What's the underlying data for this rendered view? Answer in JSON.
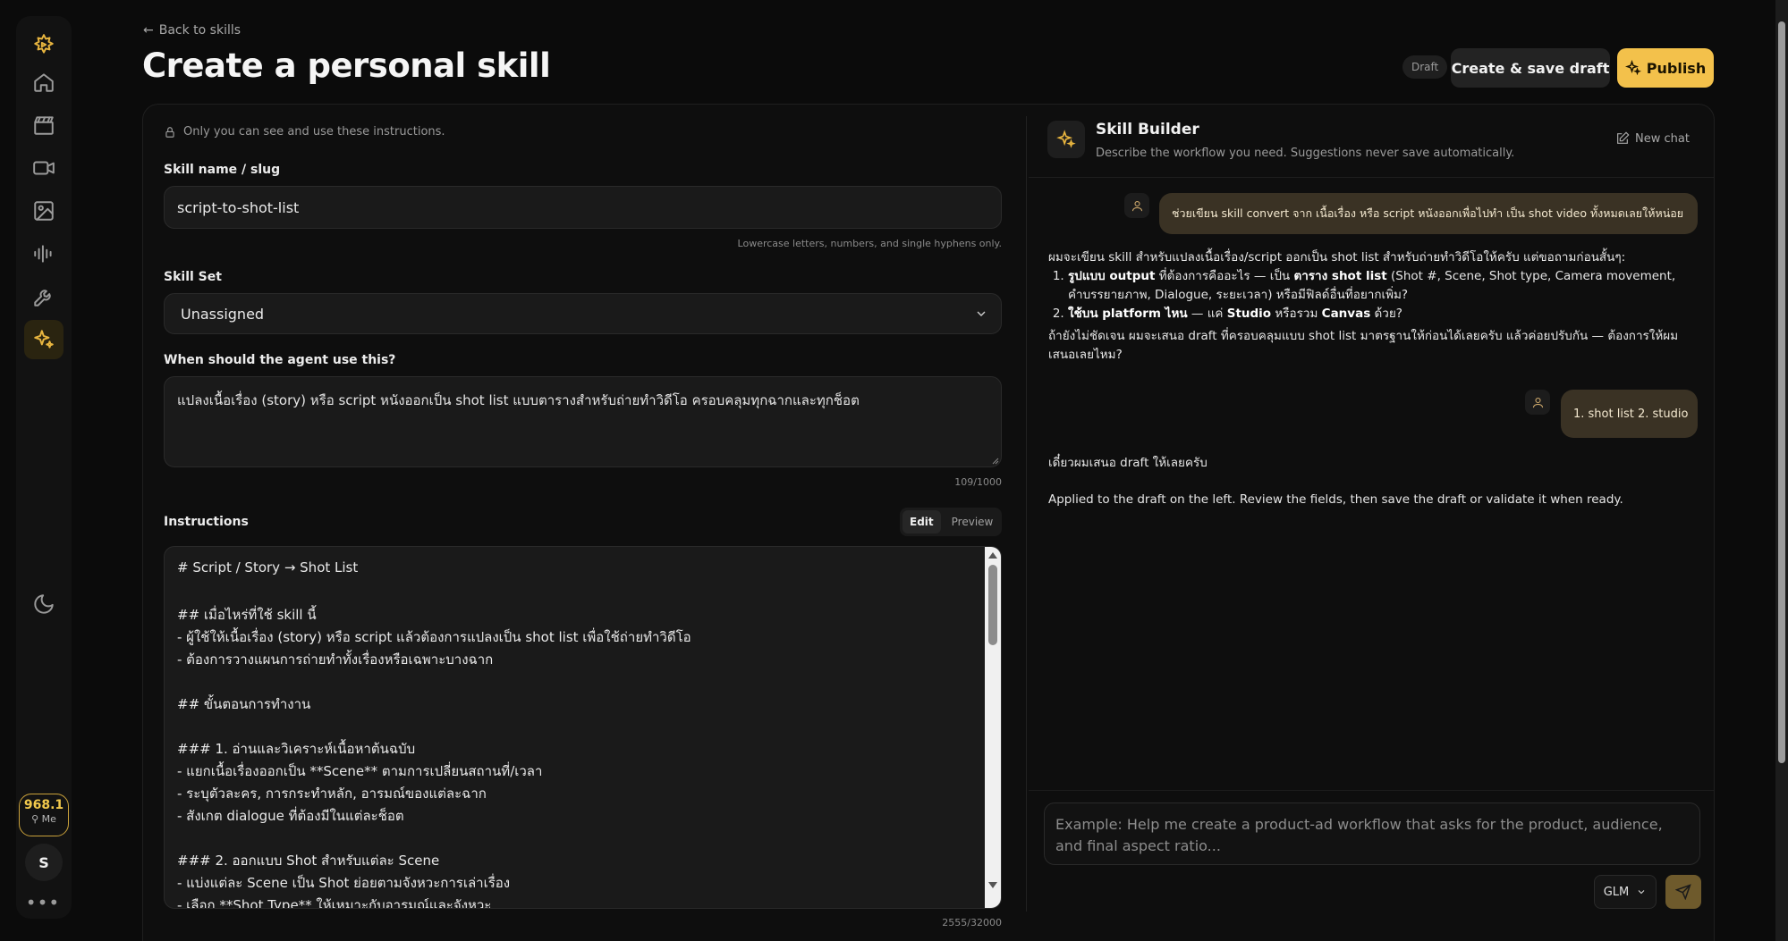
{
  "header": {
    "back_label": "Back to skills",
    "title": "Create a personal skill",
    "draft_badge": "Draft",
    "save_label": "Create & save draft",
    "publish_label": "Publish"
  },
  "sidebar": {
    "credits": "968.1",
    "me_label": "Me",
    "avatar_initial": "S",
    "more": "•••"
  },
  "form": {
    "privacy_note": "Only you can see and use these instructions.",
    "name_label": "Skill name / slug",
    "name_value": "script-to-shot-list",
    "name_hint": "Lowercase letters, numbers, and single hyphens only.",
    "skillset_label": "Skill Set",
    "skillset_value": "Unassigned",
    "when_label": "When should the agent use this?",
    "when_value": "แปลงเนื้อเรื่อง (story) หรือ script หนังออกเป็น shot list แบบตารางสำหรับถ่ายทำวิดีโอ ครอบคลุมทุกฉากและทุกช็อต",
    "when_count": "109/1000",
    "instructions_label": "Instructions",
    "edit_tab": "Edit",
    "preview_tab": "Preview",
    "instructions_count": "2555/32000",
    "instruction_lines": [
      "# Script / Story → Shot List",
      "",
      "## เมื่อไหร่ที่ใช้ skill นี้",
      "- ผู้ใช้ให้เนื้อเรื่อง (story) หรือ script แล้วต้องการแปลงเป็น shot list เพื่อใช้ถ่ายทำวิดีโอ",
      "- ต้องการวางแผนการถ่ายทำทั้งเรื่องหรือเฉพาะบางฉาก",
      "",
      "## ขั้นตอนการทำงาน",
      "",
      "### 1. อ่านและวิเคราะห์เนื้อหาต้นฉบับ",
      "- แยกเนื้อเรื่องออกเป็น **Scene** ตามการเปลี่ยนสถานที่/เวลา",
      "- ระบุตัวละคร, การกระทำหลัก, อารมณ์ของแต่ละฉาก",
      "- สังเกต dialogue ที่ต้องมีในแต่ละช็อต",
      "",
      "### 2. ออกแบบ Shot สำหรับแต่ละ Scene",
      "- แบ่งแต่ละ Scene เป็น Shot ย่อยตามจังหวะการเล่าเรื่อง",
      "- เลือก **Shot Type** ให้เหมาะกับอารมณ์และจังหวะ"
    ]
  },
  "builder": {
    "title": "Skill Builder",
    "subtitle": "Describe the workflow you need. Suggestions never save automatically.",
    "new_chat": "New chat",
    "user_msg_1": "ช่วยเขียน skill convert จาก เนื้อเรื่อง หรือ script หนังออกเพื่อไปทำ เป็น shot video ทั้งหมดเลยให้หน่อย",
    "assistant_intro": "ผมจะเขียน skill สำหรับแปลงเนื้อเรื่อง/script ออกเป็น shot list สำหรับถ่ายทำวิดีโอให้ครับ แต่ขอถามก่อนสั้นๆ:",
    "q1_bold": "รูปแบบ output",
    "q1_mid": " ที่ต้องการคืออะไร — เป็น ",
    "q1_bold2": "ตาราง shot list",
    "q1_rest": " (Shot #, Scene, Shot type, Camera movement, คำบรรยายภาพ, Dialogue, ระยะเวลา) หรือมีฟิลด์อื่นที่อยากเพิ่ม?",
    "q2_bold": "ใช้บน platform ไหน",
    "q2_mid": " — แค่ ",
    "q2_bold2": "Studio",
    "q2_mid2": " หรือรวม ",
    "q2_bold3": "Canvas",
    "q2_rest": " ด้วย?",
    "assistant_outro": "ถ้ายังไม่ชัดเจน ผมจะเสนอ draft ที่ครอบคลุมแบบ shot list มาตรฐานให้ก่อนได้เลยครับ แล้วค่อยปรับกัน — ต้องการให้ผมเสนอเลยไหม?",
    "user_msg_2": "1. shot list 2. studio",
    "assistant_2": "เดี๋ยวผมเสนอ draft ให้เลยครับ",
    "assistant_3": "Applied to the draft on the left. Review the fields, then save the draft or validate it when ready.",
    "input_placeholder": "Example: Help me create a product-ad workflow that asks for the product, audience, and final aspect ratio...",
    "model": "GLM"
  },
  "colors": {
    "accent": "#f3c14b",
    "bubble": "#3a3224",
    "background": "#0b0b0b"
  }
}
